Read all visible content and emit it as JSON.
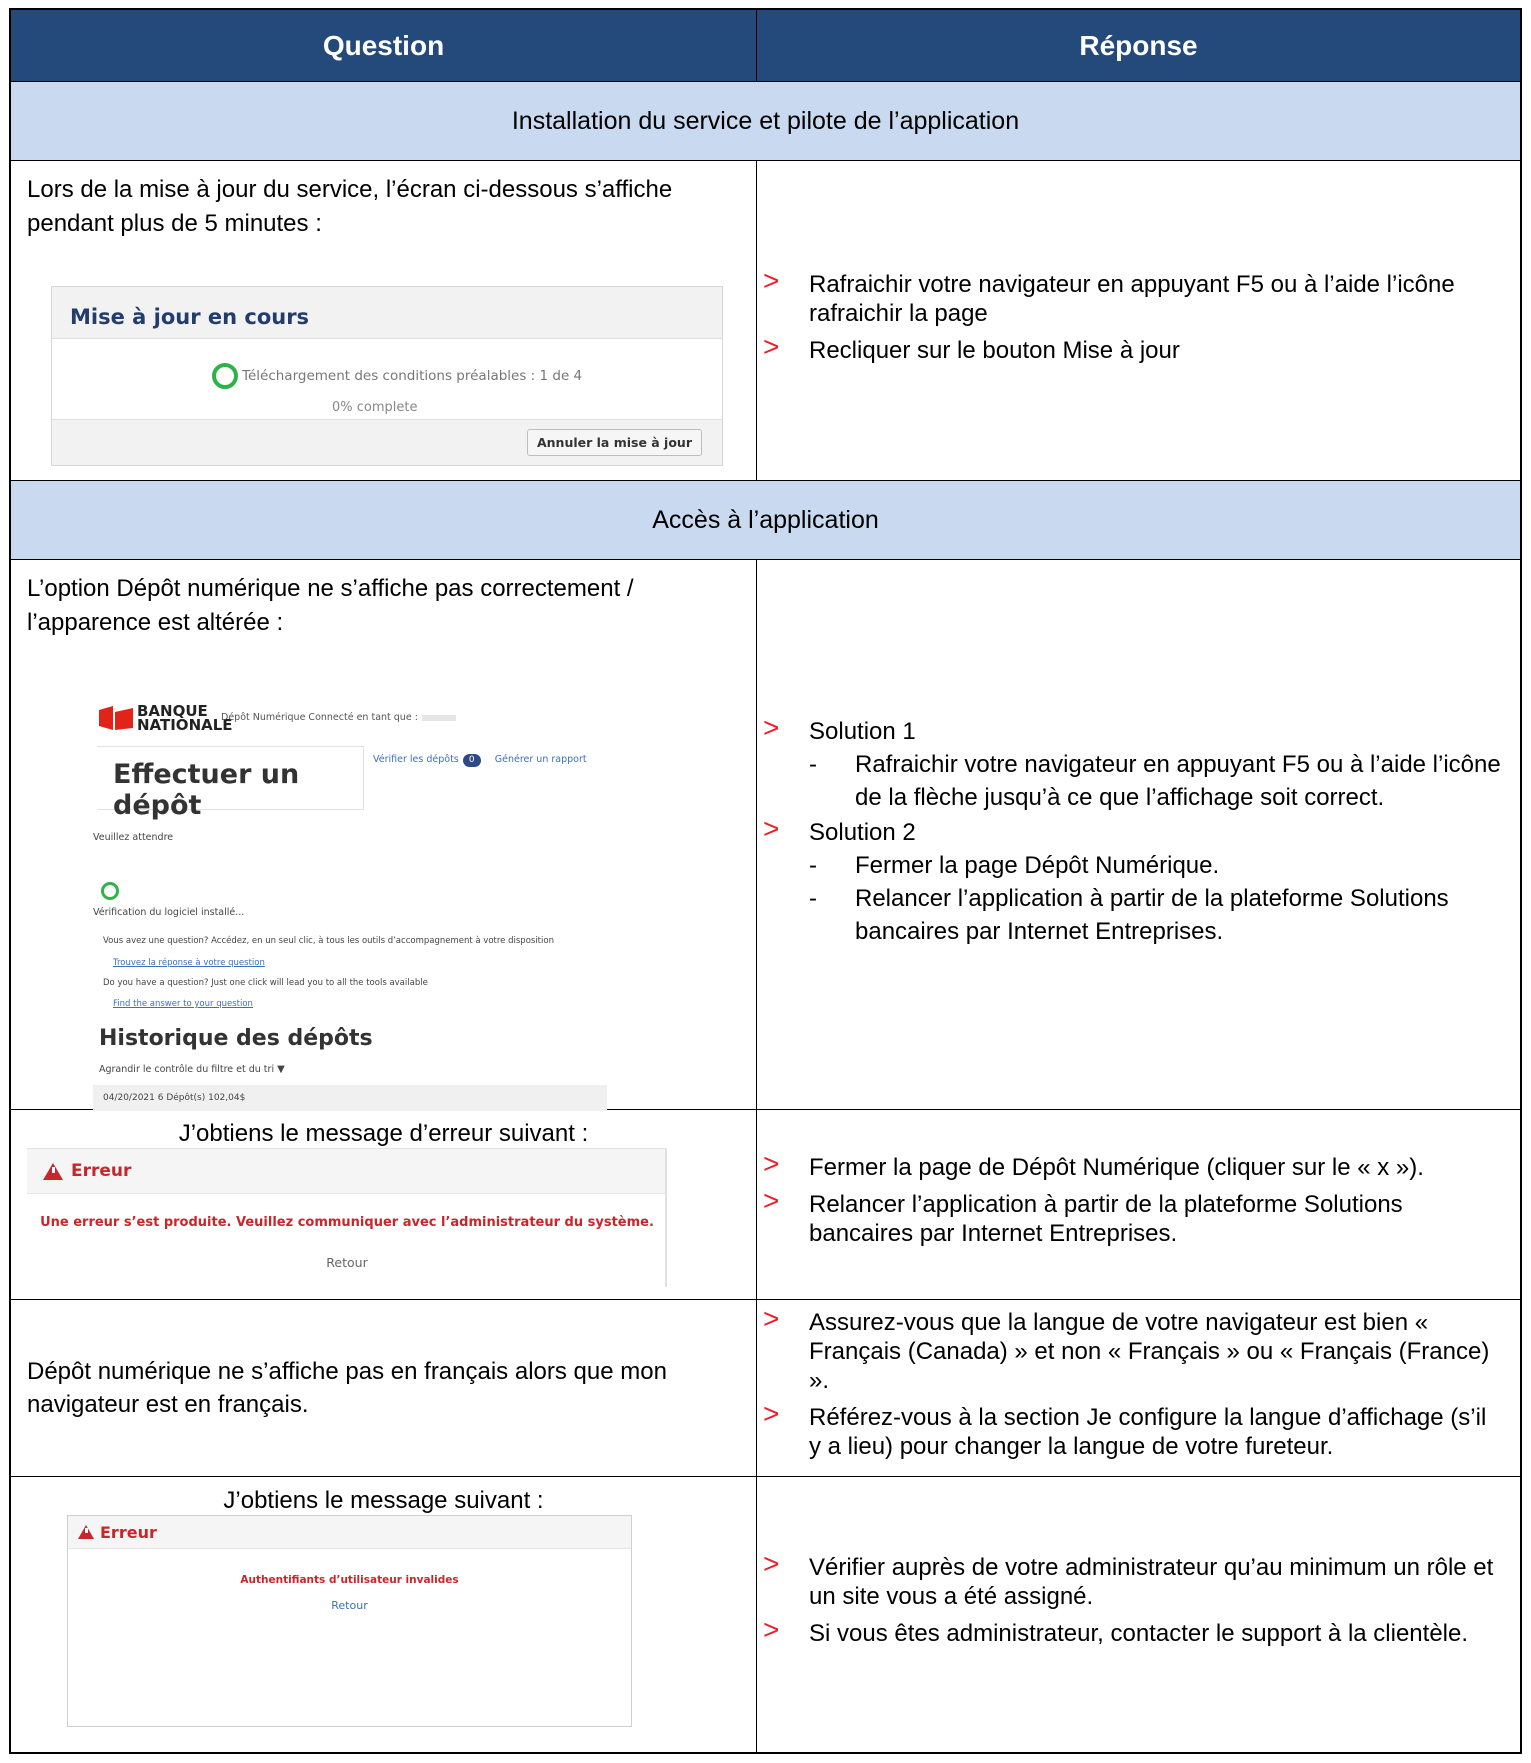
{
  "header": {
    "question": "Question",
    "answer": "Réponse"
  },
  "sections": {
    "install": "Installation du service et pilote de l’application",
    "access": "Accès à l’application"
  },
  "rows": {
    "r1": {
      "question": [
        "Lors de la mise à jour du service, l’écran ci-dessous s’affiche",
        "pendant plus de 5 minutes :"
      ],
      "mock": {
        "title": "Mise à jour en cours",
        "download": "Téléchargement des conditions préalables : 1 de 4",
        "percent": "0% complete",
        "cancel": "Annuler la mise à jour"
      },
      "answers": [
        "Rafraichir votre navigateur en appuyant F5 ou à l’aide l’icône rafraichir la page",
        "Recliquer sur le bouton Mise à jour"
      ]
    },
    "r2": {
      "question": [
        "L’option Dépôt numérique ne s’affiche pas correctement /",
        "l’apparence est altérée :"
      ],
      "mock": {
        "bank_line1": "BANQUE",
        "bank_line2": "NATIONALE",
        "connected": "Dépôt Numérique Connecté en tant que :",
        "title": "Effectuer un dépôt",
        "verify": "Vérifier les dépôts",
        "badge": "0",
        "report": "Générer un rapport",
        "wait": "Veuillez attendre",
        "checking": "Vérification du logiciel installé...",
        "help_fr": "Vous avez une question? Accédez, en un seul clic, à tous les outils d’accompagnement à votre disposition",
        "link_fr": "Trouvez la réponse à votre question",
        "help_en": "Do you have a question? Just one click will lead you to all the tools available",
        "link_en": "Find the answer to your question",
        "history": "Historique des dépôts",
        "filter": "Agrandir le contrôle du filtre et du tri",
        "summary": "04/20/2021 6 Dépôt(s) 102,04$"
      },
      "answers": {
        "s1": "Solution 1",
        "s1_items": [
          "Rafraichir votre navigateur en appuyant F5 ou à l’aide l’icône de la flèche jusqu’à ce que l’affichage soit correct."
        ],
        "s2": "Solution 2",
        "s2_items": [
          "Fermer la page Dépôt Numérique.",
          "Relancer l’application à partir de la plateforme Solutions bancaires par Internet Entreprises."
        ]
      }
    },
    "r3": {
      "question": "J’obtiens le message d’erreur suivant :",
      "mock": {
        "title": "Erreur",
        "message": "Une erreur s’est produite. Veuillez communiquer avec l’administrateur du système.",
        "back": "Retour"
      },
      "answers": [
        "Fermer la page de Dépôt Numérique (cliquer sur le « x »).",
        "Relancer l’application à partir de la plateforme Solutions bancaires par Internet Entreprises."
      ]
    },
    "r4": {
      "question": "Dépôt numérique ne s’affiche pas en français alors que mon navigateur est en français.",
      "answers": [
        "Assurez-vous que la langue de votre navigateur est bien « Français (Canada) » et non « Français » ou « Français (France) ».",
        "Référez-vous à la section Je configure la langue d’affichage (s’il y a lieu) pour changer la langue de votre fureteur."
      ]
    },
    "r5": {
      "question": "J’obtiens le message suivant :",
      "mock": {
        "title": "Erreur",
        "message": "Authentifiants d’utilisateur invalides",
        "back": "Retour"
      },
      "answers": [
        "Vérifier auprès de votre administrateur qu’au minimum un rôle et un site vous a été assigné.",
        "Si vous êtes administrateur, contacter le support à la clientèle."
      ]
    }
  },
  "colors": {
    "header_bg": "#234a7a",
    "section_bg": "#c9d9ef",
    "arrow": "#e8202a",
    "error_red": "#c9252c"
  }
}
